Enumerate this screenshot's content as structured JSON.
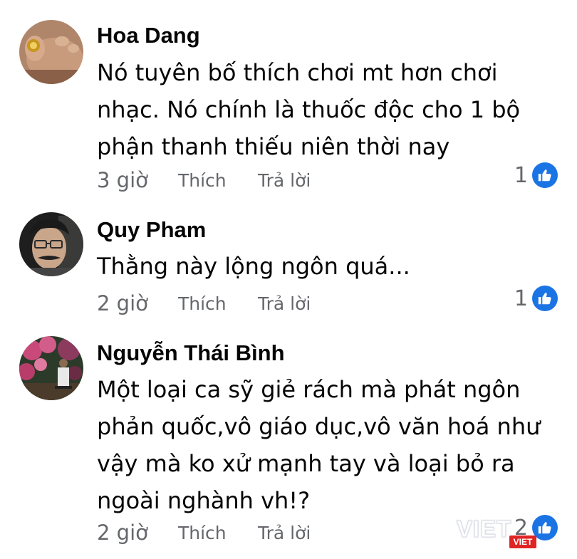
{
  "comments": [
    {
      "author": "Hoa Dang",
      "text": "Nó tuyên bố thích chơi mt hơn chơi nhạc. Nó chính là thuốc độc cho 1 bộ phận thanh thiếu niên thời nay",
      "time": "3 giờ",
      "like_label": "Thích",
      "reply_label": "Trả lời",
      "reaction_count": "1",
      "reaction_icon": "thumbs-up-icon"
    },
    {
      "author": "Quy Pham",
      "text": "Thằng này lộng ngôn quá...",
      "time": "2 giờ",
      "like_label": "Thích",
      "reply_label": "Trả lời",
      "reaction_count": "1",
      "reaction_icon": "thumbs-up-icon"
    },
    {
      "author": "Nguyễn Thái Bình",
      "text": "Một loại ca sỹ giẻ rách mà phát ngôn phản quốc,vô giáo dục,vô văn hoá như vậy mà ko xử mạnh tay và loại bỏ ra ngoài nghành  vh!?",
      "time": "2 giờ",
      "like_label": "Thích",
      "reply_label": "Trả lời",
      "reaction_count": "2",
      "reaction_icon": "thumbs-up-icon"
    }
  ],
  "watermark": {
    "text": "VIET",
    "badge": "VIET"
  },
  "colors": {
    "like_blue": "#1b74e4",
    "meta_gray": "#65676b",
    "text": "#050505",
    "watermark_red": "#e02424"
  }
}
